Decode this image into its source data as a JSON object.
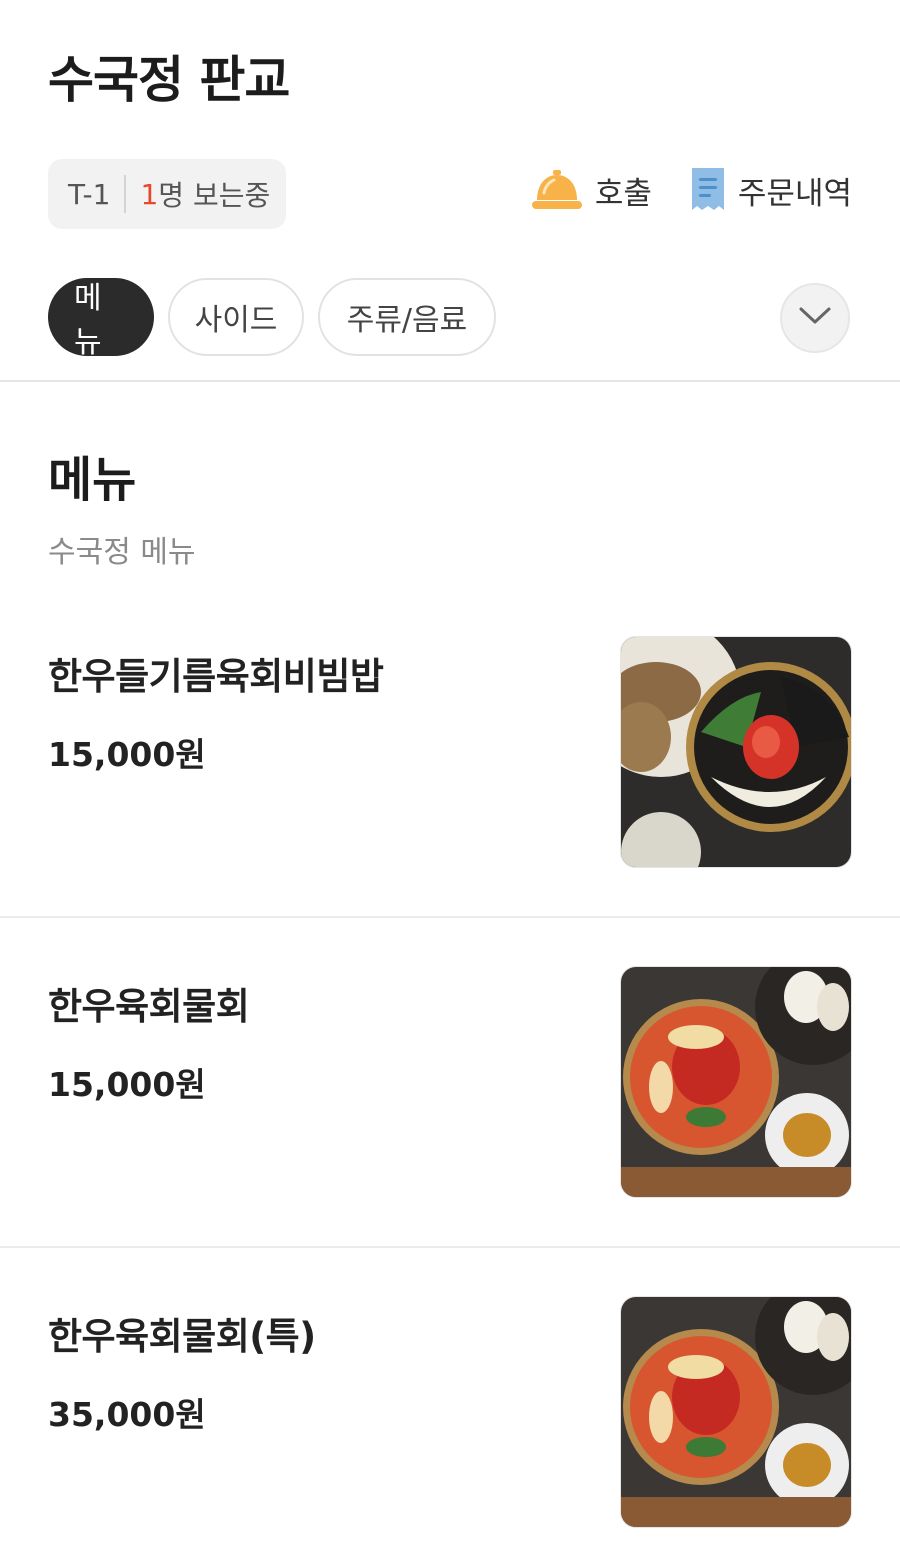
{
  "header": {
    "store_name": "수국정 판교",
    "table_code": "T-1",
    "viewer_count": "1",
    "viewer_suffix": "명 보는중",
    "call_label": "호출",
    "call_icon": "bell-icon",
    "orders_label": "주문내역",
    "orders_icon": "receipt-icon"
  },
  "tabs": [
    {
      "label": "메뉴",
      "active": true
    },
    {
      "label": "사이드",
      "active": false
    },
    {
      "label": "주류/음료",
      "active": false
    }
  ],
  "expand_icon": "chevron-down-icon",
  "section": {
    "title": "메뉴",
    "subtitle": "수국정 메뉴"
  },
  "items": [
    {
      "name": "한우들기름육회비빔밥",
      "price": "15,000원"
    },
    {
      "name": "한우육회물회",
      "price": "15,000원"
    },
    {
      "name": "한우육회물회(특)",
      "price": "35,000원"
    }
  ],
  "colors": {
    "accent_red": "#e8472c",
    "bell_orange": "#f7b24a",
    "receipt_blue": "#8fbde6",
    "active_tab": "#2b2b2b"
  }
}
